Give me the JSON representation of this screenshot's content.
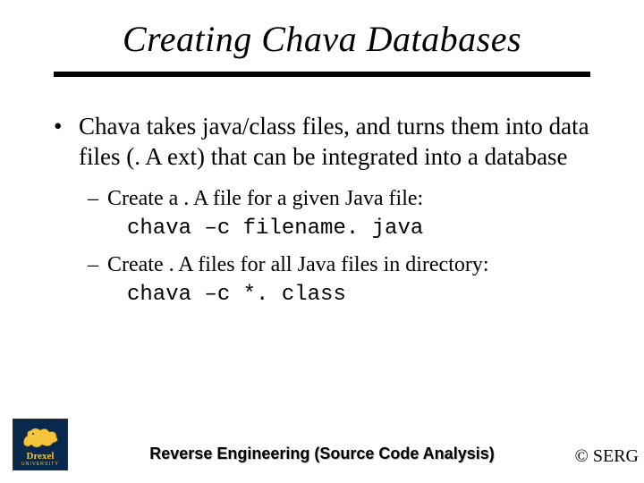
{
  "title": "Creating Chava Databases",
  "bullet1": "Chava takes java/class files, and turns them into data files (. A ext) that can be integrated into a database",
  "sub1_text": "Create a . A file for a given Java file:",
  "sub1_code": "chava –c filename. java",
  "sub2_text": "Create . A files for all Java files in directory:",
  "sub2_code": "chava –c *. class",
  "footer": "Reverse Engineering (Source Code Analysis)",
  "copyright": "© SERG",
  "logo": {
    "name": "Drexel",
    "sub": "UNIVERSITY"
  }
}
